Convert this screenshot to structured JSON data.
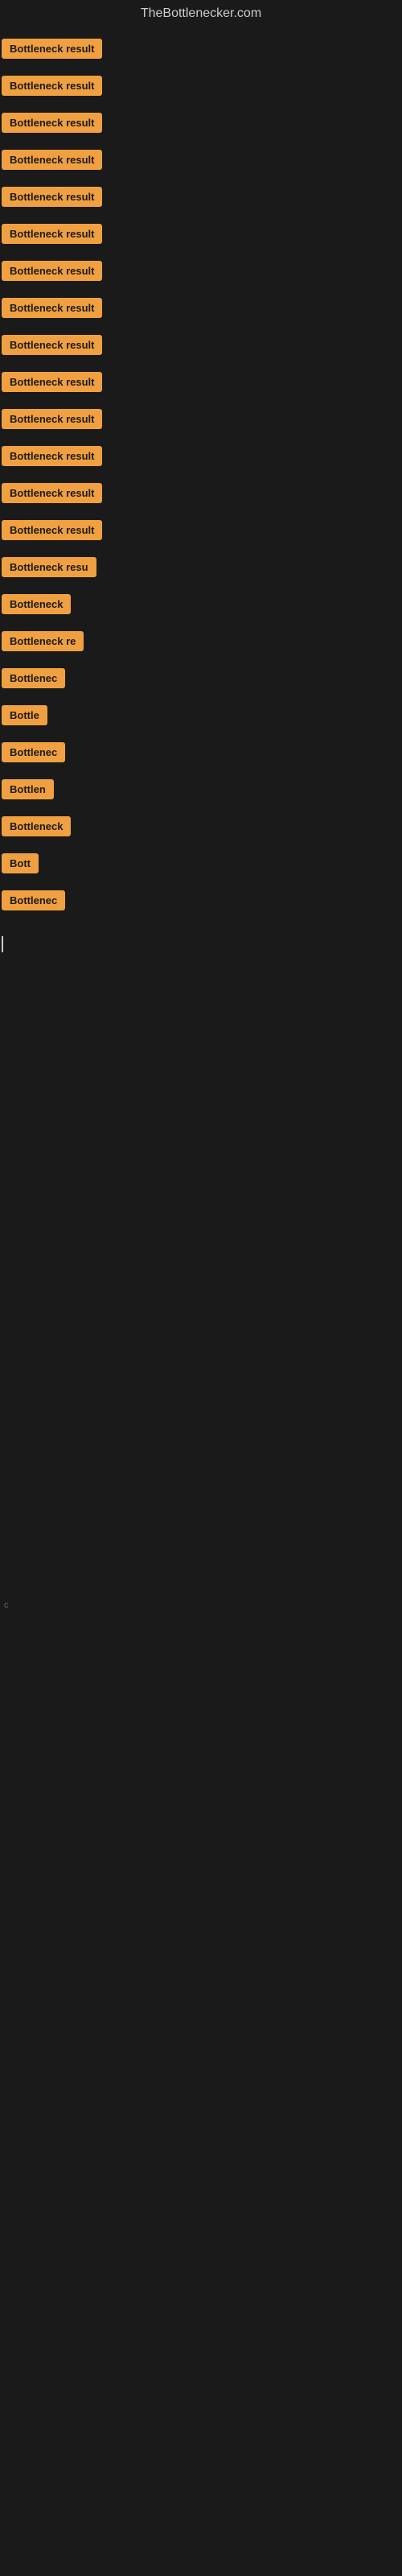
{
  "site": {
    "title": "TheBottlenecker.com"
  },
  "bottleneck_rows": [
    {
      "id": 1,
      "label": "Bottleneck result",
      "width_class": "row-1"
    },
    {
      "id": 2,
      "label": "Bottleneck result",
      "width_class": "row-2"
    },
    {
      "id": 3,
      "label": "Bottleneck result",
      "width_class": "row-3"
    },
    {
      "id": 4,
      "label": "Bottleneck result",
      "width_class": "row-4"
    },
    {
      "id": 5,
      "label": "Bottleneck result",
      "width_class": "row-5"
    },
    {
      "id": 6,
      "label": "Bottleneck result",
      "width_class": "row-6"
    },
    {
      "id": 7,
      "label": "Bottleneck result",
      "width_class": "row-7"
    },
    {
      "id": 8,
      "label": "Bottleneck result",
      "width_class": "row-8"
    },
    {
      "id": 9,
      "label": "Bottleneck result",
      "width_class": "row-9"
    },
    {
      "id": 10,
      "label": "Bottleneck result",
      "width_class": "row-10"
    },
    {
      "id": 11,
      "label": "Bottleneck result",
      "width_class": "row-11"
    },
    {
      "id": 12,
      "label": "Bottleneck result",
      "width_class": "row-12"
    },
    {
      "id": 13,
      "label": "Bottleneck result",
      "width_class": "row-13"
    },
    {
      "id": 14,
      "label": "Bottleneck result",
      "width_class": "row-14"
    },
    {
      "id": 15,
      "label": "Bottleneck resu",
      "width_class": "row-15"
    },
    {
      "id": 16,
      "label": "Bottleneck",
      "width_class": "row-16"
    },
    {
      "id": 17,
      "label": "Bottleneck re",
      "width_class": "row-17"
    },
    {
      "id": 18,
      "label": "Bottlenec",
      "width_class": "row-18"
    },
    {
      "id": 19,
      "label": "Bottle",
      "width_class": "row-19"
    },
    {
      "id": 20,
      "label": "Bottlenec",
      "width_class": "row-20"
    },
    {
      "id": 21,
      "label": "Bottlen",
      "width_class": "row-21"
    },
    {
      "id": 22,
      "label": "Bottleneck",
      "width_class": "row-22"
    },
    {
      "id": 23,
      "label": "Bott",
      "width_class": "row-23"
    },
    {
      "id": 24,
      "label": "Bottlenec",
      "width_class": "row-24"
    }
  ],
  "cursor_visible": true,
  "footer_char": "c"
}
